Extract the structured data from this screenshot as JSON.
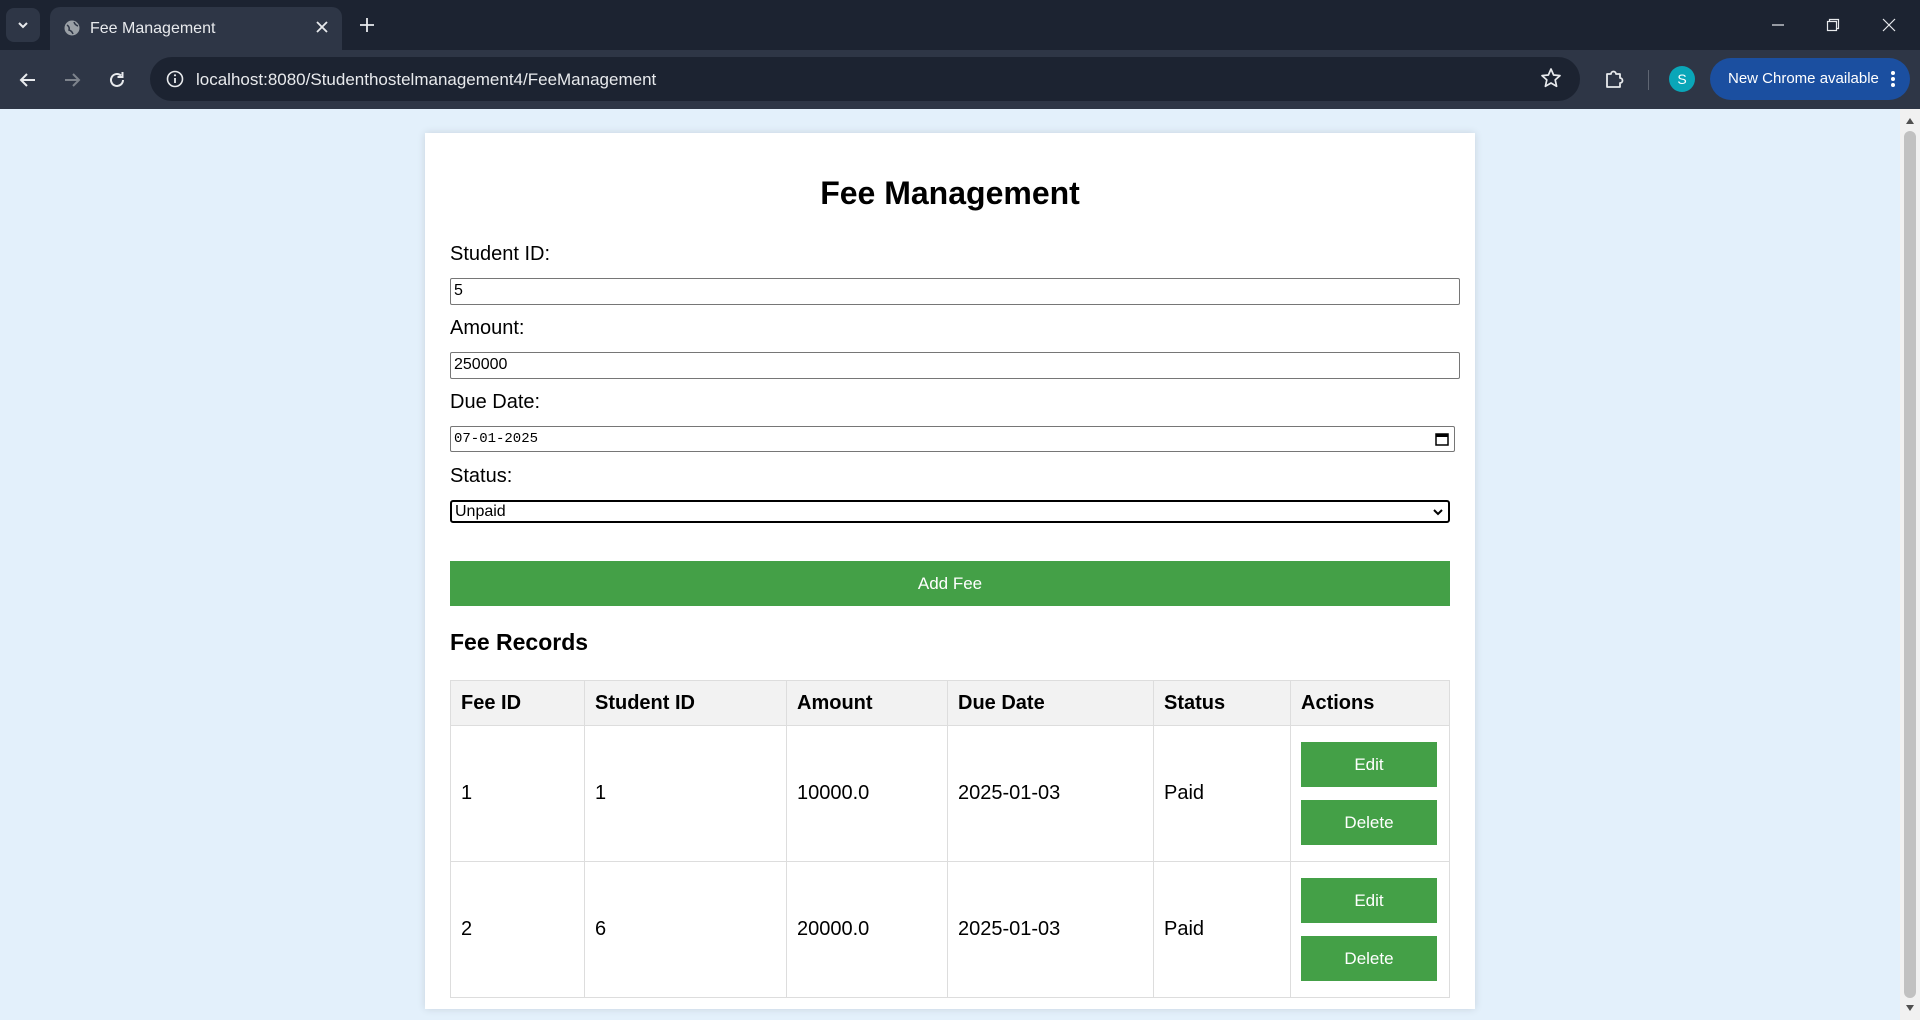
{
  "browser": {
    "tab_title": "Fee Management",
    "url": "localhost:8080/Studenthostelmanagement4/FeeManagement",
    "profile_initial": "S",
    "update_label": "New Chrome available"
  },
  "form": {
    "title": "Fee Management",
    "student_id_label": "Student ID:",
    "student_id_value": "5",
    "amount_label": "Amount:",
    "amount_value": "250000",
    "due_date_label": "Due Date:",
    "due_date_value": "07-01-2025",
    "status_label": "Status:",
    "status_value": "Unpaid",
    "submit_label": "Add Fee"
  },
  "records": {
    "title": "Fee Records",
    "columns": [
      "Fee ID",
      "Student ID",
      "Amount",
      "Due Date",
      "Status",
      "Actions"
    ],
    "rows": [
      {
        "fee_id": "1",
        "student_id": "1",
        "amount": "10000.0",
        "due_date": "2025-01-03",
        "status": "Paid"
      },
      {
        "fee_id": "2",
        "student_id": "6",
        "amount": "20000.0",
        "due_date": "2025-01-03",
        "status": "Paid"
      }
    ],
    "edit_label": "Edit",
    "delete_label": "Delete"
  },
  "colors": {
    "accent_green": "#44a047",
    "page_background": "#e3f0fb",
    "chrome_dark": "#1c2331"
  }
}
